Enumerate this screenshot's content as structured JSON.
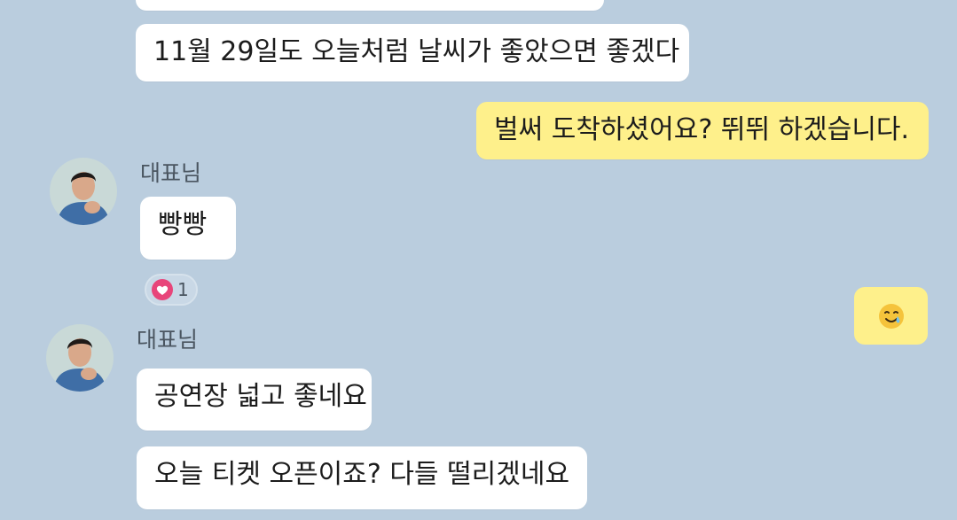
{
  "chat": {
    "messages": [
      {
        "sender": "other",
        "text": "11월 29일도 오늘처럼 날씨가 좋았으면 좋겠다"
      },
      {
        "sender": "me",
        "text": "벌써 도착하셨어요? 뛰뛰 하겠습니다."
      },
      {
        "sender": "other",
        "name": "대표님",
        "text": "빵빵",
        "reaction": {
          "icon": "heart-icon",
          "count": "1"
        }
      },
      {
        "sender": "me",
        "emoji": "smiling-face-with-tear-icon"
      },
      {
        "sender": "other",
        "name": "대표님",
        "text": "공연장 넓고 좋네요"
      },
      {
        "sender": "other",
        "text": "오늘 티켓 오픈이죠? 다들 떨리겠네요"
      }
    ]
  },
  "colors": {
    "background": "#bacdde",
    "my_bubble": "#fef08b",
    "other_bubble": "#ffffff",
    "reaction_heart": "#e8457a"
  }
}
